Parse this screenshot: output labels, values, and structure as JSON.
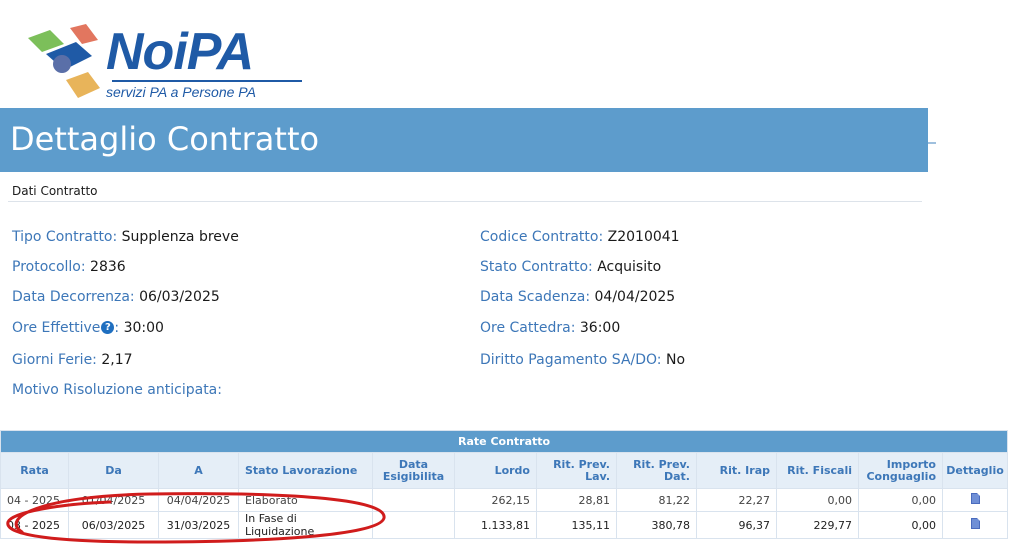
{
  "logo": {
    "brand": "NoiPA",
    "tagline": "servizi PA a Persone PA"
  },
  "page_title": "Dettaglio Contratto",
  "section_title": "Dati Contratto",
  "fields": {
    "tipo_contratto": {
      "label": "Tipo Contratto:",
      "value": "Supplenza breve"
    },
    "protocollo": {
      "label": "Protocollo:",
      "value": "2836"
    },
    "data_decorrenza": {
      "label": "Data Decorrenza:",
      "value": "06/03/2025"
    },
    "ore_effettive": {
      "label": "Ore Effettive",
      "suffix": ":",
      "value": "30:00"
    },
    "giorni_ferie": {
      "label": "Giorni Ferie:",
      "value": "2,17"
    },
    "motivo_risoluzione": {
      "label": "Motivo Risoluzione anticipata:",
      "value": ""
    },
    "codice_contratto": {
      "label": "Codice Contratto:",
      "value": "Z2010041"
    },
    "stato_contratto": {
      "label": "Stato Contratto:",
      "value": "Acquisito"
    },
    "data_scadenza": {
      "label": "Data Scadenza:",
      "value": "04/04/2025"
    },
    "ore_cattedra": {
      "label": "Ore Cattedra:",
      "value": "36:00"
    },
    "diritto_pagamento": {
      "label": "Diritto Pagamento SA/DO:",
      "value": "No"
    }
  },
  "table": {
    "caption": "Rate Contratto",
    "headers": [
      "Rata",
      "Da",
      "A",
      "Stato Lavorazione",
      "Data Esigibilita",
      "Lordo",
      "Rit. Prev. Lav.",
      "Rit. Prev. Dat.",
      "Rit. Irap",
      "Rit. Fiscali",
      "Importo Conguaglio",
      "Dettaglio"
    ],
    "rows": [
      [
        "04 - 2025",
        "01/04/2025",
        "04/04/2025",
        "Elaborato",
        "",
        "262,15",
        "28,81",
        "81,22",
        "22,27",
        "0,00",
        "0,00"
      ],
      [
        "03 - 2025",
        "06/03/2025",
        "31/03/2025",
        "In Fase di Liquidazione",
        "",
        "1.133,81",
        "135,11",
        "380,78",
        "96,37",
        "229,77",
        "0,00"
      ]
    ]
  },
  "colors": {
    "header_bar": "#5d9ccc",
    "label": "#3d77b8",
    "annotation": "#d01c1c"
  }
}
